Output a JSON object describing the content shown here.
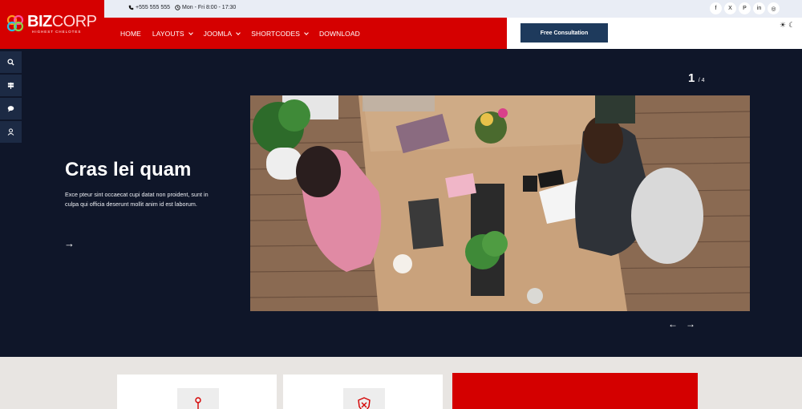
{
  "brand": {
    "name_bold": "BIZ",
    "name_rest": "CORP",
    "tagline": "HIGHEST CHELOTES"
  },
  "topbar": {
    "phone": "+555 555 555",
    "hours": "Mon - Fri 8:00 - 17:30"
  },
  "socials": [
    {
      "icon": "facebook-icon",
      "glyph": "f"
    },
    {
      "icon": "x-icon",
      "glyph": "X"
    },
    {
      "icon": "pinterest-icon",
      "glyph": "P"
    },
    {
      "icon": "linkedin-icon",
      "glyph": "in"
    },
    {
      "icon": "dribbble-icon",
      "glyph": "◎"
    }
  ],
  "nav": {
    "items": [
      {
        "label": "HOME",
        "dropdown": false
      },
      {
        "label": "LAYOUTS",
        "dropdown": true
      },
      {
        "label": "JOOMLA",
        "dropdown": true
      },
      {
        "label": "SHORTCODES",
        "dropdown": true
      },
      {
        "label": "DOWNLOAD",
        "dropdown": false
      }
    ],
    "cta": "Free Consultation"
  },
  "theme": {
    "light": "☀",
    "dark": "☾"
  },
  "hero": {
    "title": "Cras lei quam",
    "text": "Exce pteur sint occaecat cupi datat non proident, sunt in culpa qui officia deserunt mollit anim id est laborum.",
    "arrow": "→",
    "counter_current": "1",
    "counter_total": "/ 4",
    "prev": "←",
    "next": "→"
  },
  "colors": {
    "brand_red": "#d50000",
    "dark_navy": "#0f1629",
    "cta_blue": "#1e3a5c"
  }
}
